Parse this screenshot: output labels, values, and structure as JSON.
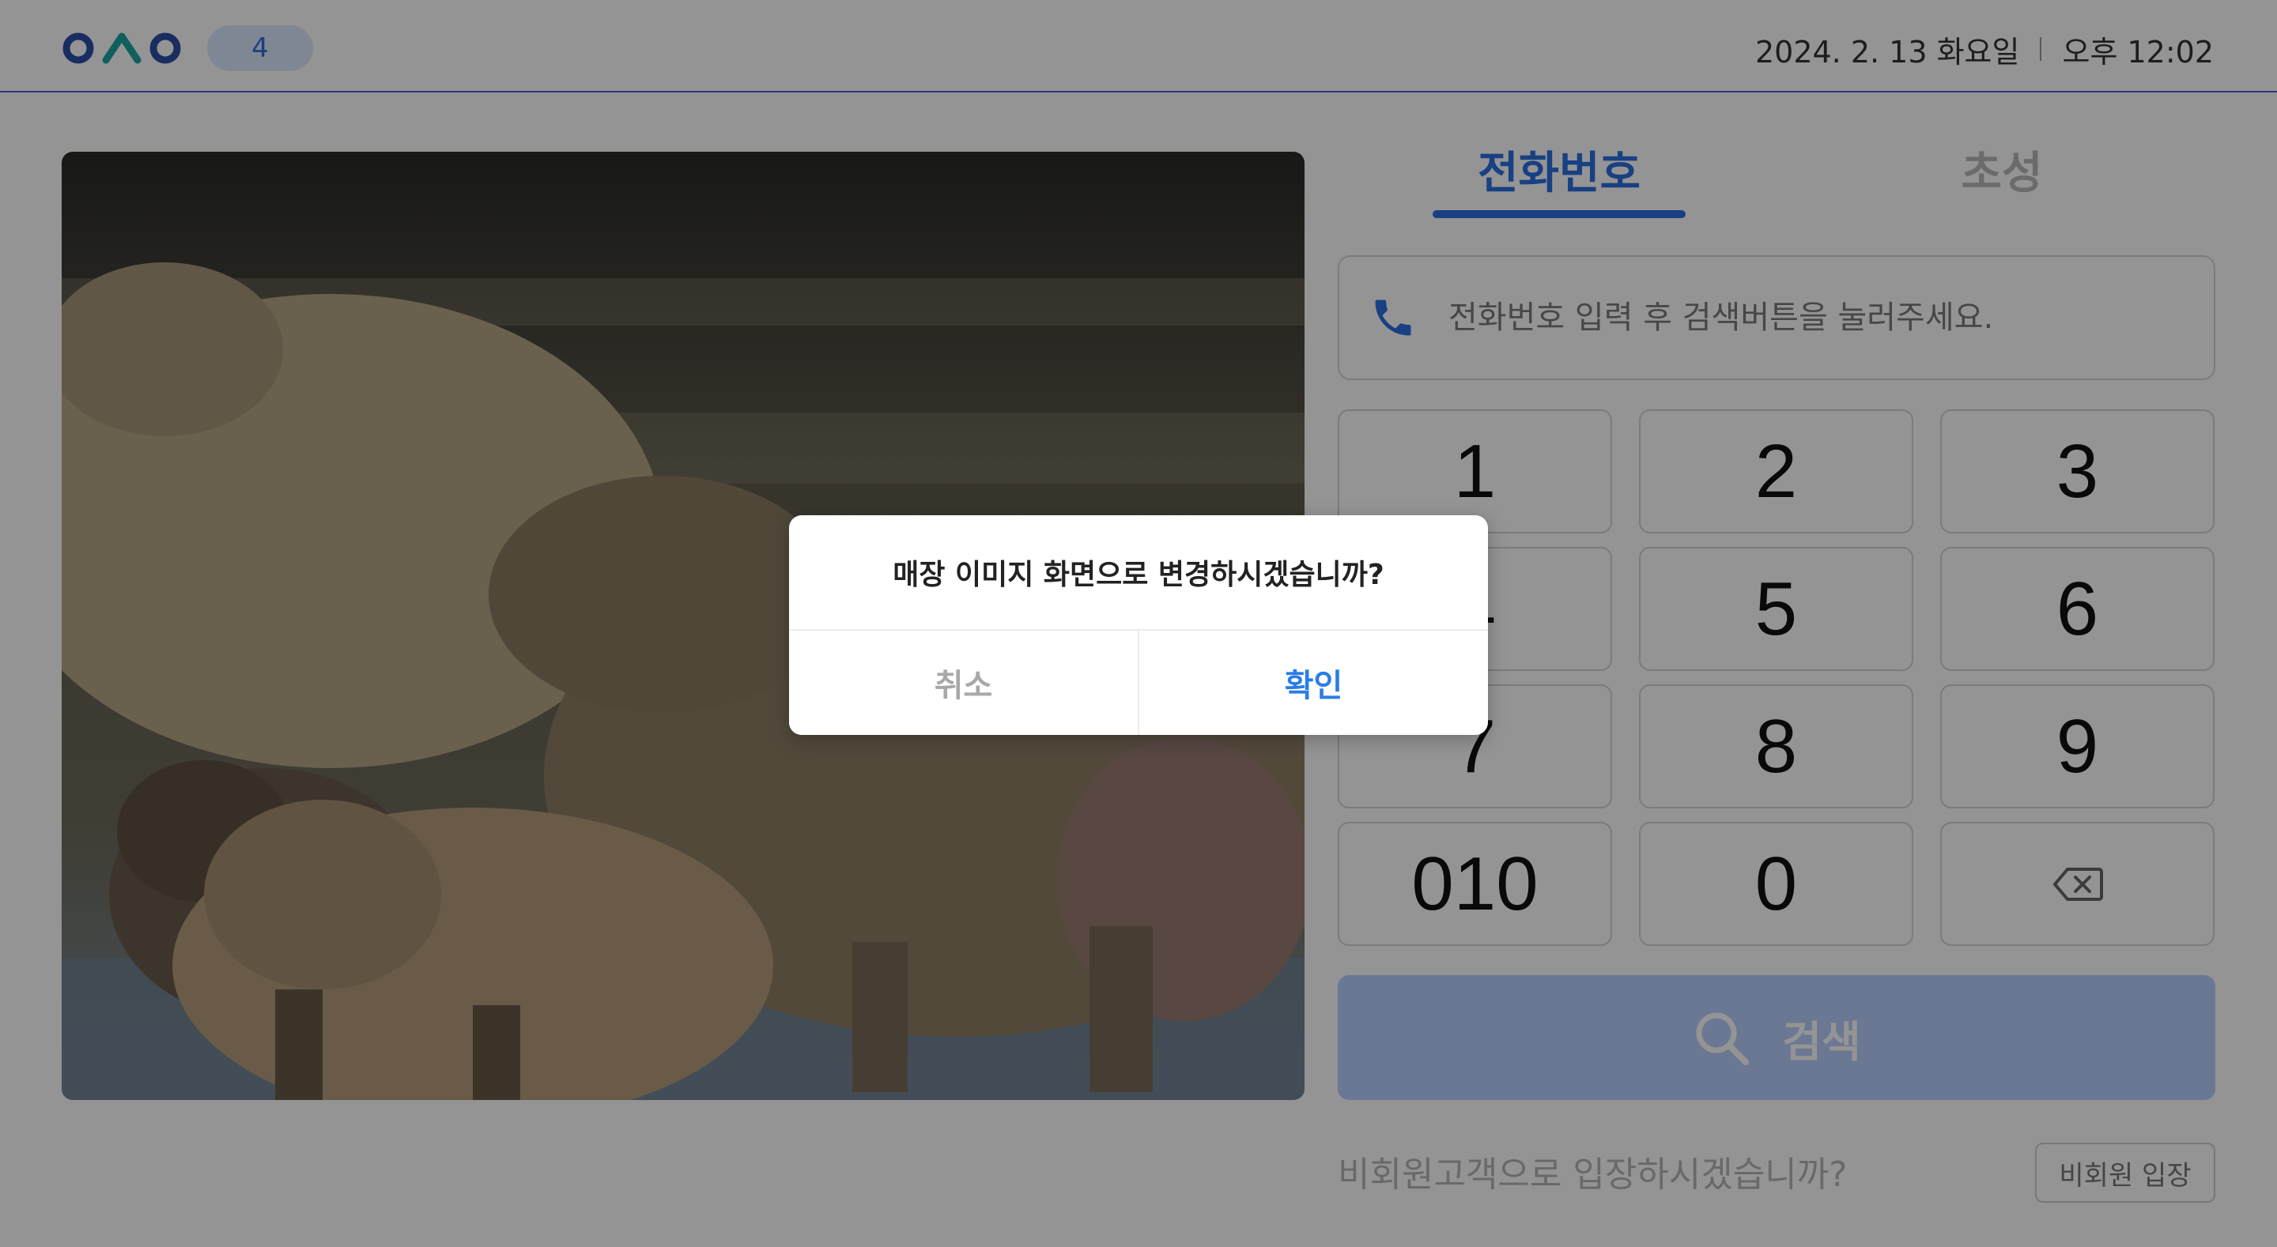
{
  "header": {
    "count": "4",
    "date": "2024. 2. 13 화요일",
    "time": "오후 12:02"
  },
  "hero": {
    "icon": "capybara-photo"
  },
  "tabs": [
    {
      "label": "전화번호",
      "active": true
    },
    {
      "label": "초성",
      "active": false
    }
  ],
  "phone_input": {
    "placeholder": "전화번호 입력 후 검색버튼을 눌러주세요.",
    "value": "",
    "icon": "phone-icon"
  },
  "keypad": {
    "keys": [
      "1",
      "2",
      "3",
      "4",
      "5",
      "6",
      "7",
      "8",
      "9",
      "010",
      "0"
    ],
    "backspace_icon": "backspace-icon"
  },
  "search": {
    "label": "검색",
    "icon": "search-icon"
  },
  "guest": {
    "question": "비회원고객으로 입장하시겠습니까?",
    "button": "비회원 입장"
  },
  "dialog": {
    "message": "매장 이미지 화면으로 변경하시겠습니까?",
    "cancel": "취소",
    "confirm": "확인"
  },
  "colors": {
    "accent": "#2a6fe0",
    "search_button": "#b9cfff",
    "badge_bg": "#dce8ff",
    "confirm_text": "#2a7de8",
    "overlay": "rgba(0,0,0,0.42)"
  }
}
